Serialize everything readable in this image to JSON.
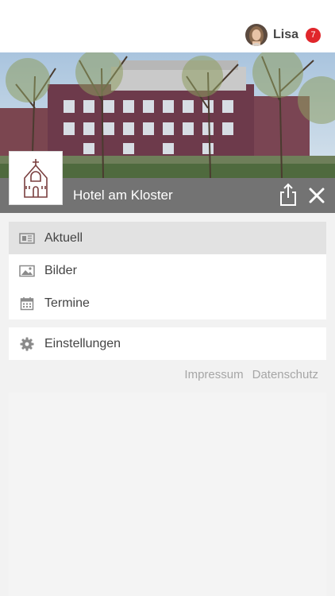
{
  "user": {
    "name": "Lisa",
    "notification_count": "7",
    "badge_color": "#e0262b"
  },
  "hotel": {
    "name": "Hotel am Kloster",
    "logo_icon": "chapel-icon"
  },
  "menu": {
    "items": [
      {
        "label": "Aktuell",
        "icon": "newspaper-icon",
        "active": true
      },
      {
        "label": "Bilder",
        "icon": "image-icon",
        "active": false
      },
      {
        "label": "Termine",
        "icon": "calendar-icon",
        "active": false
      }
    ],
    "settings": {
      "label": "Einstellungen",
      "icon": "gear-icon"
    }
  },
  "footer": {
    "impressum": "Impressum",
    "datenschutz": "Datenschutz"
  },
  "colors": {
    "titlebar": "#737373",
    "active_item": "#e2e2e2",
    "logo_stroke": "#7a3f3f"
  }
}
